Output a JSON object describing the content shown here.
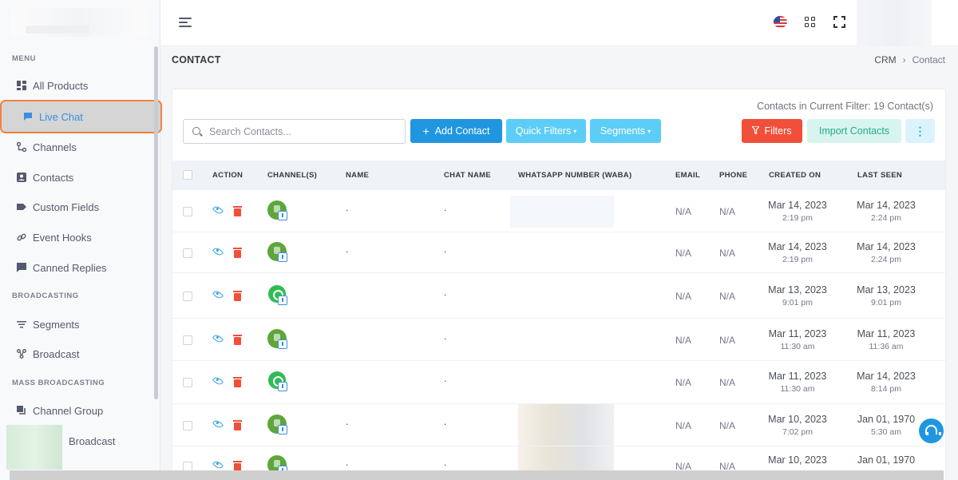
{
  "sidebar": {
    "sections": [
      {
        "title": "MENU"
      },
      {
        "title": "BROADCASTING"
      },
      {
        "title": "MASS BROADCASTING"
      }
    ],
    "items": [
      {
        "label": "All Products",
        "icon": "dashboard-icon"
      },
      {
        "label": "Live Chat",
        "icon": "chat-icon",
        "active": true
      },
      {
        "label": "Channels",
        "icon": "channels-icon"
      },
      {
        "label": "Contacts",
        "icon": "contact-card-icon"
      },
      {
        "label": "Custom Fields",
        "icon": "tag-icon"
      },
      {
        "label": "Event Hooks",
        "icon": "link-icon"
      },
      {
        "label": "Canned Replies",
        "icon": "comment-icon"
      },
      {
        "label": "Segments",
        "icon": "filter-lines-icon"
      },
      {
        "label": "Broadcast",
        "icon": "broadcast-icon"
      },
      {
        "label": "Channel Group",
        "icon": "copy-icon"
      },
      {
        "label": "Broadcast",
        "icon": "broadcast-icon"
      }
    ]
  },
  "header": {
    "page_title": "CONTACT",
    "breadcrumb": [
      "CRM",
      "Contact"
    ]
  },
  "toolbar": {
    "filter_count": "Contacts in Current Filter: 19 Contact(s)",
    "search_placeholder": "Search Contacts...",
    "add_contact": "Add Contact",
    "quick_filters": "Quick Filters",
    "segments": "Segments",
    "filters": "Filters",
    "import_contacts": "Import Contacts",
    "more": "⋮"
  },
  "table": {
    "columns": [
      "ACTION",
      "CHANNEL(S)",
      "NAME",
      "CHAT NAME",
      "WHATSAPP NUMBER (WABA)",
      "EMAIL",
      "PHONE",
      "CREATED ON",
      "LAST SEEN"
    ],
    "rows": [
      {
        "channel": "webchat",
        "name": ".",
        "chat_name": ".",
        "email": "N/A",
        "phone": "N/A",
        "created_date": "Mar 14, 2023",
        "created_time": "2:19 pm",
        "seen_date": "Mar 14, 2023",
        "seen_time": "2:24 pm"
      },
      {
        "channel": "webchat",
        "name": ".",
        "chat_name": ".",
        "email": "N/A",
        "phone": "N/A",
        "created_date": "Mar 14, 2023",
        "created_time": "2:19 pm",
        "seen_date": "Mar 14, 2023",
        "seen_time": "2:24 pm"
      },
      {
        "channel": "whatsapp",
        "name": "",
        "chat_name": ".",
        "email": "N/A",
        "phone": "N/A",
        "created_date": "Mar 13, 2023",
        "created_time": "9:01 pm",
        "seen_date": "Mar 13, 2023",
        "seen_time": "9:01 pm"
      },
      {
        "channel": "webchat",
        "name": "",
        "chat_name": ".",
        "email": "N/A",
        "phone": "N/A",
        "created_date": "Mar 11, 2023",
        "created_time": "11:30 am",
        "seen_date": "Mar 11, 2023",
        "seen_time": "11:36 am"
      },
      {
        "channel": "whatsapp",
        "name": "",
        "chat_name": ".",
        "email": "N/A",
        "phone": "N/A",
        "created_date": "Mar 11, 2023",
        "created_time": "11:30 am",
        "seen_date": "Mar 14, 2023",
        "seen_time": "8:14 pm"
      },
      {
        "channel": "webchat",
        "name": ".",
        "chat_name": ".",
        "email": "N/A",
        "phone": "N/A",
        "created_date": "Mar 10, 2023",
        "created_time": "7:02 pm",
        "seen_date": "Jan 01, 1970",
        "seen_time": "5:30 am"
      },
      {
        "channel": "webchat",
        "name": ".",
        "chat_name": ".",
        "email": "N/A",
        "phone": "N/A",
        "created_date": "Mar 10, 2023",
        "created_time": "",
        "seen_date": "Jan 01, 1970",
        "seen_time": ""
      }
    ]
  }
}
